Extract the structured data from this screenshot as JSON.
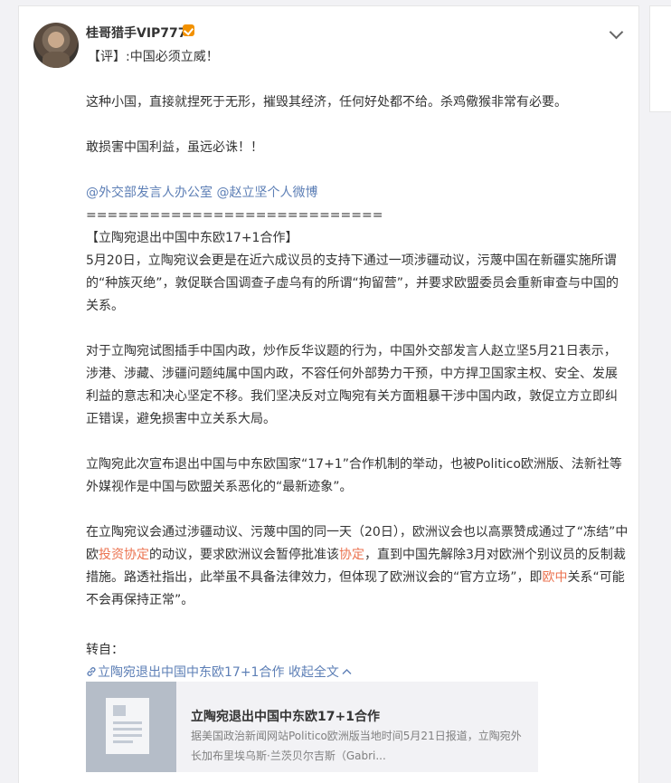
{
  "post": {
    "username": "桂哥猎手VIP777",
    "comment": "【评】:中国必须立威！",
    "paragraphs": {
      "p1": "这种小国，直接就捏死于无形，摧毁其经济，任何好处都不给。杀鸡儆猴非常有必要。",
      "p2": "敢损害中国利益，虽远必诛！！",
      "mention1": "@外交部发言人办公室",
      "mention2": "@赵立坚个人微博",
      "divider": "============================",
      "headline": "【立陶宛退出中国中东欧17+1合作】",
      "p3": "5月20日，立陶宛议会更是在近六成议员的支持下通过一项涉疆动议，污蔑中国在新疆实施所谓的“种族灭绝”，敦促联合国调查子虚乌有的所谓“拘留营”，并要求欧盟委员会重新审查与中国的关系。",
      "p4": "对于立陶宛试图插手中国内政，炒作反华议题的行为，中国外交部发言人赵立坚5月21日表示，涉港、涉藏、涉疆问题纯属中国内政，不容任何外部势力干预，中方捍卫国家主权、安全、发展利益的意志和决心坚定不移。我们坚决反对立陶宛有关方面粗暴干涉中国内政，敦促立方立即纠正错误，避免损害中立关系大局。",
      "p5": "立陶宛此次宣布退出中国与中东欧国家“17+1”合作机制的举动，也被Politico欧洲版、法新社等外媒视作是中国与欧盟关系恶化的“最新迹象”。",
      "p6a": "在立陶宛议会通过涉疆动议、污蔑中国的同一天（20日），欧洲议会也以高票赞成通过了“冻结”中欧",
      "p6link1": "投资协定",
      "p6b": "的动议，要求欧洲议会暂停批准该",
      "p6link2": "协定",
      "p6c": "，直到中国先解除3月对欧洲个别议员的反制裁措施。路透社指出，此举虽不具备法律效力，但体现了欧洲议会的“官方立场”，即",
      "p6link3": "欧中",
      "p6d": "关系“可能不会再保持正常”。"
    },
    "repost_label": "转自：",
    "article_link": "立陶宛退出中国中东欧17+1合作",
    "collapse_label": "收起全文",
    "article_card": {
      "title": "立陶宛退出中国中东欧17+1合作",
      "description": "据美国政治新闻网站Politico欧洲版当地时间5月21日报道，立陶宛外长加布里埃乌斯·兰茨贝尔吉斯（Gabri..."
    }
  },
  "icons": {
    "verified": "verified-badge-icon",
    "chevron": "chevron-down-icon",
    "link": "link-icon",
    "collapse": "chevron-up-icon",
    "thumbnail": "article-doc-icon"
  },
  "colors": {
    "link": "#eb7350",
    "mention": "#5d7fb6",
    "verified": "#f29100"
  }
}
